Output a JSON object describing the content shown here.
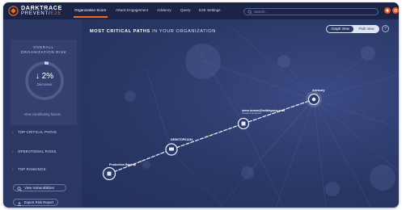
{
  "app": {
    "logo_line1": "DARKTRACE",
    "logo_line2_main": "PREVENT/",
    "logo_line2_accent": "E2E"
  },
  "nav": {
    "items": [
      {
        "label": "Organization Score",
        "active": true
      },
      {
        "label": "Attack Engagement",
        "active": false
      },
      {
        "label": "Advisory",
        "active": false
      },
      {
        "label": "Query",
        "active": false
      },
      {
        "label": "E2E Settings",
        "active": false
      }
    ],
    "search_placeholder": "Search..."
  },
  "sidebar": {
    "risk_title_line1": "OVERALL",
    "risk_title_line2": "ORGANIZATION RISK",
    "risk_value": "↓ 2%",
    "risk_change_label": "Decrease",
    "risk_link": "View contributing factors",
    "items": [
      {
        "label": "TOP CRITICAL PATHS"
      },
      {
        "label": "OPERATIONAL RISKS"
      },
      {
        "label": "TOP RANKINGS"
      }
    ],
    "buttons": [
      {
        "label": "View Vulnerabilities",
        "icon": "search-icon"
      },
      {
        "label": "Export Risk Report",
        "icon": "download-icon"
      }
    ]
  },
  "main": {
    "title_bold": "MOST CRITICAL PATHS",
    "title_rest": " IN YOUR ORGANIZATION",
    "graph_view_label": "Graph View",
    "path_view_label": "Path View",
    "help_label": "?",
    "nodes": [
      {
        "label": "Production Backup",
        "sub": ""
      },
      {
        "label": "DESKTOP01234",
        "sub": ""
      },
      {
        "label": "steve.brown@holdingsinc.com",
        "sub": "Systems Engineer"
      },
      {
        "label": "Advisory",
        "sub": ""
      }
    ]
  },
  "colors": {
    "accent": "#f06a1e",
    "background": "#24305a",
    "sidebar": "#2b3864",
    "path_line": "#e6e9f7"
  }
}
